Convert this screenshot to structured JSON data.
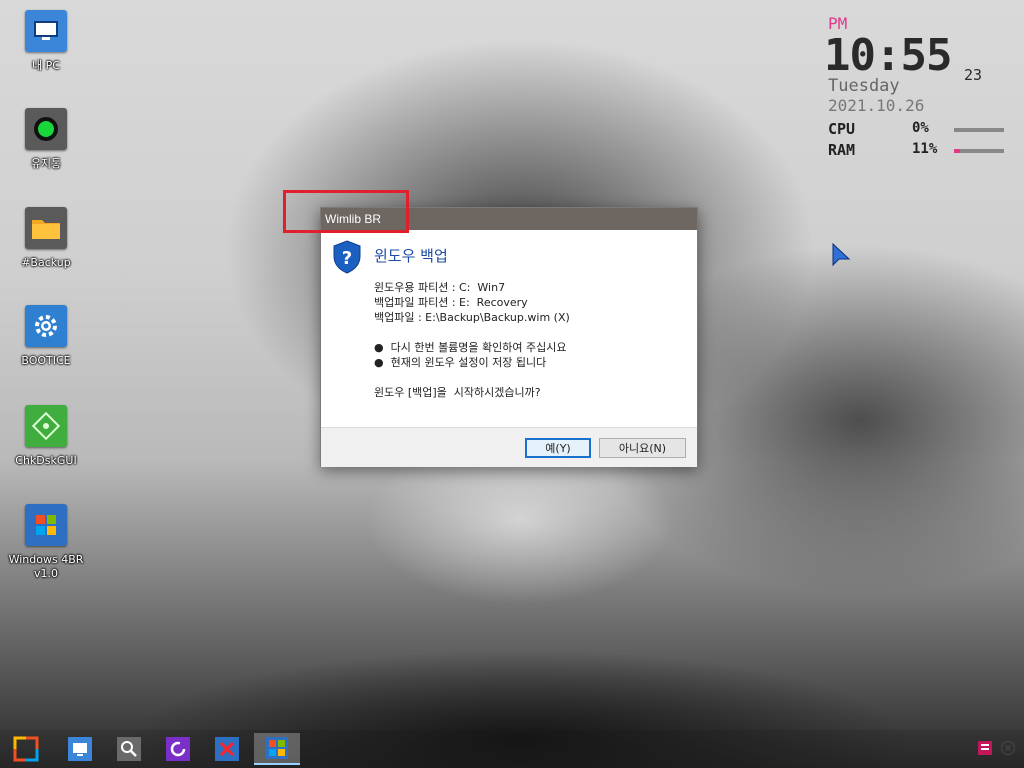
{
  "desktop": {
    "icons": [
      {
        "label": "내 PC",
        "icon": "monitor-icon"
      },
      {
        "label": "유지통",
        "icon": "recycle-bin-icon"
      },
      {
        "label": "#Backup",
        "icon": "folder-icon"
      },
      {
        "label": "BOOTICE",
        "icon": "gear-icon"
      },
      {
        "label": "ChkDskGUI",
        "icon": "disk-check-icon"
      },
      {
        "label": "Windows 4BR v1.0",
        "icon": "windows-tiles-icon"
      }
    ]
  },
  "widget": {
    "ampm": "PM",
    "time": "10:55",
    "seconds": "23",
    "day": "Tuesday",
    "date": "2021.10.26",
    "cpu": {
      "label": "CPU",
      "value": "0%",
      "level": 0.0
    },
    "ram": {
      "label": "RAM",
      "value": "11%",
      "level": 0.11
    },
    "accent": "#e0398b"
  },
  "dialog": {
    "title": "Wimlib BR",
    "heading": "윈도우 백업",
    "line1": "윈도우용 파티션 : C:  Win7",
    "line2": "백업파일 파티션 : E:  Recovery",
    "line3": "백업파일 : E:\\Backup\\Backup.wim (X)",
    "bullet1": "●  다시 한번 볼륨명을 확인하여 주십시요",
    "bullet2": "●  현재의 윈도우 설정이 저장 됩니다",
    "question": "윈도우 [백업]을  시작하시겠습니까?",
    "yes_label": "예(Y)",
    "no_label": "아니요(N)",
    "icon": "shield-question-icon"
  },
  "taskbar": {
    "buttons": [
      {
        "icon": "start-icon"
      },
      {
        "icon": "monitor-icon"
      },
      {
        "icon": "search-icon"
      },
      {
        "icon": "refresh-icon"
      },
      {
        "icon": "close-x-icon"
      },
      {
        "icon": "windows-tiles-icon",
        "active": true
      }
    ],
    "tray": [
      {
        "icon": "tray-window-icon"
      },
      {
        "icon": "tray-close-icon"
      }
    ]
  }
}
